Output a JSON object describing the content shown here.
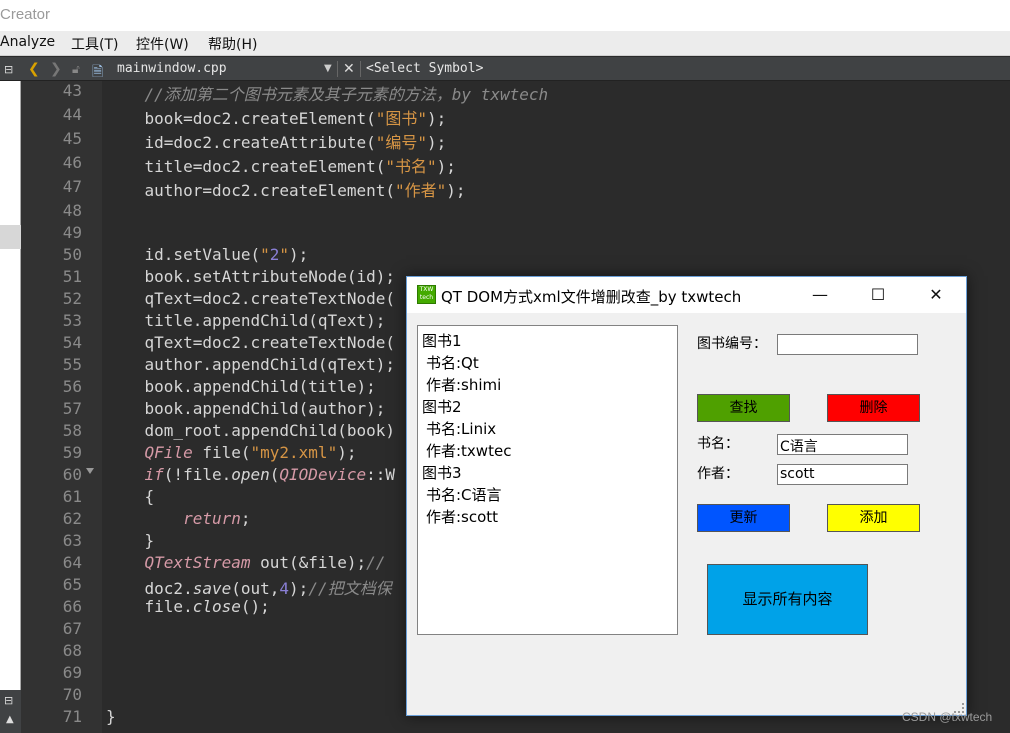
{
  "window": {
    "title": "Creator"
  },
  "menu": [
    "Analyze",
    "工具(T)",
    "控件(W)",
    "帮助(H)"
  ],
  "toolbar": {
    "filename": "mainwindow.cpp",
    "symbol": "<Select Symbol>"
  },
  "code_lines": [
    {
      "num": "43",
      "text": "    //添加第二个图书元素及其子元素的方法，by txwtech"
    },
    {
      "num": "44",
      "text": "    book=doc2.createElement(\"图书\");"
    },
    {
      "num": "45",
      "text": "    id=doc2.createAttribute(\"编号\");"
    },
    {
      "num": "46",
      "text": "    title=doc2.createElement(\"书名\");"
    },
    {
      "num": "47",
      "text": "    author=doc2.createElement(\"作者\");"
    },
    {
      "num": "48",
      "text": ""
    },
    {
      "num": "49",
      "text": ""
    },
    {
      "num": "50",
      "text": "    id.setValue(\"2\");"
    },
    {
      "num": "51",
      "text": "    book.setAttributeNode(id);"
    },
    {
      "num": "52",
      "text": "    qText=doc2.createTextNode("
    },
    {
      "num": "53",
      "text": "    title.appendChild(qText);"
    },
    {
      "num": "54",
      "text": "    qText=doc2.createTextNode("
    },
    {
      "num": "55",
      "text": "    author.appendChild(qText);"
    },
    {
      "num": "56",
      "text": "    book.appendChild(title);"
    },
    {
      "num": "57",
      "text": "    book.appendChild(author);"
    },
    {
      "num": "58",
      "text": "    dom_root.appendChild(book)"
    },
    {
      "num": "59",
      "text": "    QFile file(\"my2.xml\");"
    },
    {
      "num": "60",
      "text": "    if(!file.open(QIODevice::W"
    },
    {
      "num": "61",
      "text": "    {"
    },
    {
      "num": "62",
      "text": "        return;"
    },
    {
      "num": "63",
      "text": "    }"
    },
    {
      "num": "64",
      "text": "    QTextStream out(&file);//"
    },
    {
      "num": "65",
      "text": "    doc2.save(out,4);//把文档保"
    },
    {
      "num": "66",
      "text": "    file.close();"
    },
    {
      "num": "67",
      "text": ""
    },
    {
      "num": "68",
      "text": ""
    },
    {
      "num": "69",
      "text": ""
    },
    {
      "num": "70",
      "text": ""
    },
    {
      "num": "71",
      "text": "}"
    }
  ],
  "app": {
    "title": "QT DOM方式xml文件增删改查_by txwtech",
    "logo_text": "TXW tech",
    "controls": {
      "minimize": "—",
      "maximize": "☐",
      "close": "✕"
    },
    "list_items": [
      "图书1",
      " 书名:Qt",
      " 作者:shimi",
      "图书2",
      " 书名:Linix",
      " 作者:txwtec",
      "图书3",
      " 书名:C语言",
      " 作者:scott"
    ],
    "book_id_label": "图书编号：",
    "book_id_value": "",
    "find_button": "查找",
    "delete_button": "删除",
    "name_label": "书名：",
    "name_value": "C语言",
    "author_label": "作者：",
    "author_value": "scott",
    "update_button": "更新",
    "add_button": "添加",
    "show_all_button": "显示所有内容"
  },
  "colors": {
    "find": "#4fa000",
    "delete": "#ff0000",
    "update": "#0055ff",
    "add": "#ffff00",
    "show_all": "#00a2e8"
  },
  "watermark": "CSDN @txwtech"
}
